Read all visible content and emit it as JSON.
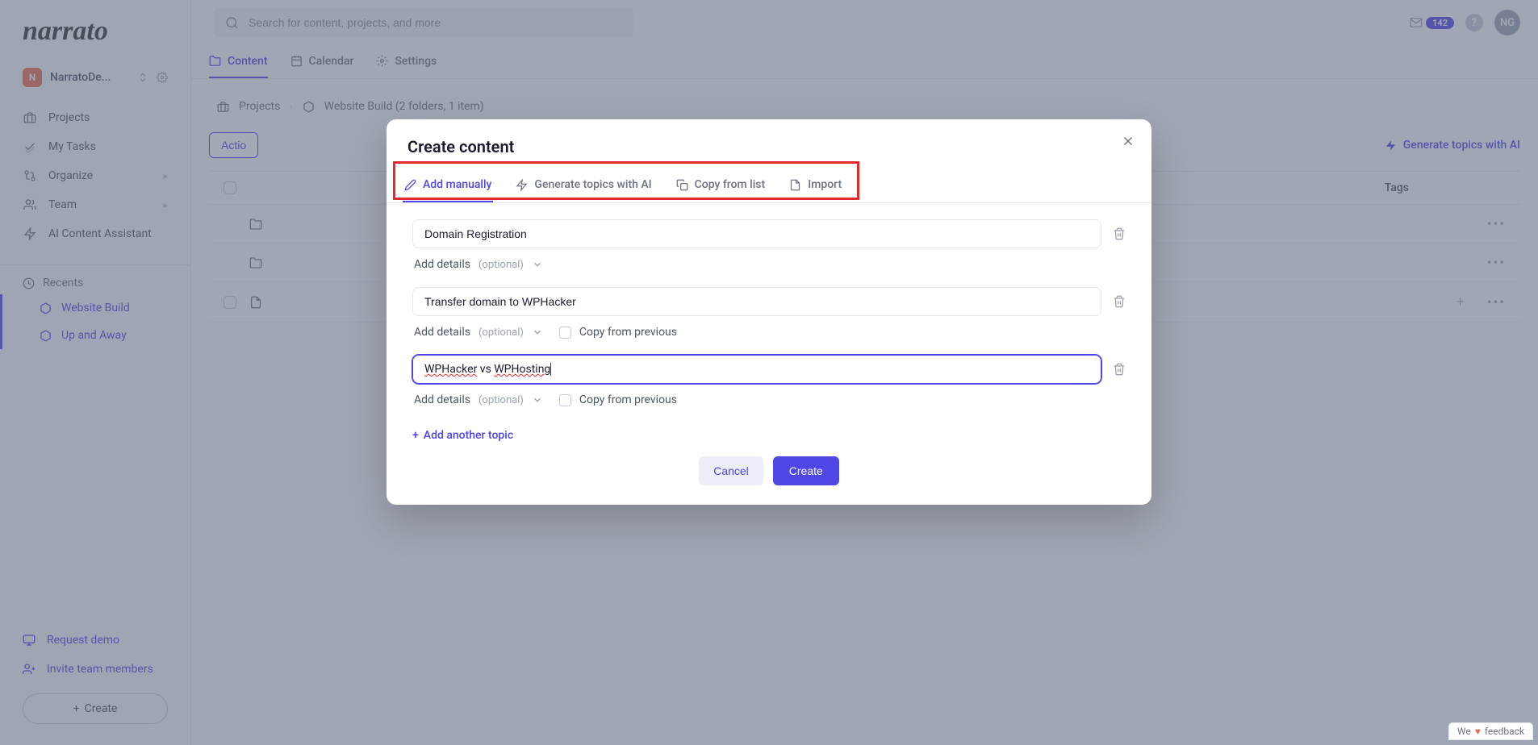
{
  "logo": "narrato",
  "workspace": {
    "initial": "N",
    "name": "NarratoDe..."
  },
  "sidebar": {
    "items": [
      {
        "label": "Projects"
      },
      {
        "label": "My Tasks"
      },
      {
        "label": "Organize"
      },
      {
        "label": "Team"
      },
      {
        "label": "AI Content Assistant"
      }
    ],
    "recents_label": "Recents",
    "recents": [
      {
        "label": "Website Build"
      },
      {
        "label": "Up and Away"
      }
    ],
    "bottom": {
      "request_demo": "Request demo",
      "invite": "Invite team members",
      "create": "Create"
    }
  },
  "search": {
    "placeholder": "Search for content, projects, and more"
  },
  "topbar": {
    "notif_count": "142",
    "avatar": "NG"
  },
  "maintabs": {
    "content": "Content",
    "calendar": "Calendar",
    "settings": "Settings"
  },
  "breadcrumb": {
    "root": "Projects",
    "current": "Website Build (2 folders, 1 item)"
  },
  "toolbar": {
    "actions": "Actio",
    "generate": "Generate topics with AI"
  },
  "table": {
    "headers": {
      "tags": "Tags"
    }
  },
  "modal": {
    "title": "Create content",
    "tabs": {
      "manual": "Add manually",
      "ai": "Generate topics with AI",
      "copy": "Copy from list",
      "import": "Import"
    },
    "topics": [
      {
        "value": "Domain Registration"
      },
      {
        "value": "Transfer domain to WPHacker"
      },
      {
        "value": "WPHacker vs WPHosting"
      }
    ],
    "details": {
      "label": "Add details",
      "optional": "(optional)",
      "copy_prev": "Copy from previous"
    },
    "add_another": "Add another topic",
    "cancel": "Cancel",
    "create": "Create"
  },
  "feedback": {
    "prefix": "We",
    "label": "feedback"
  }
}
